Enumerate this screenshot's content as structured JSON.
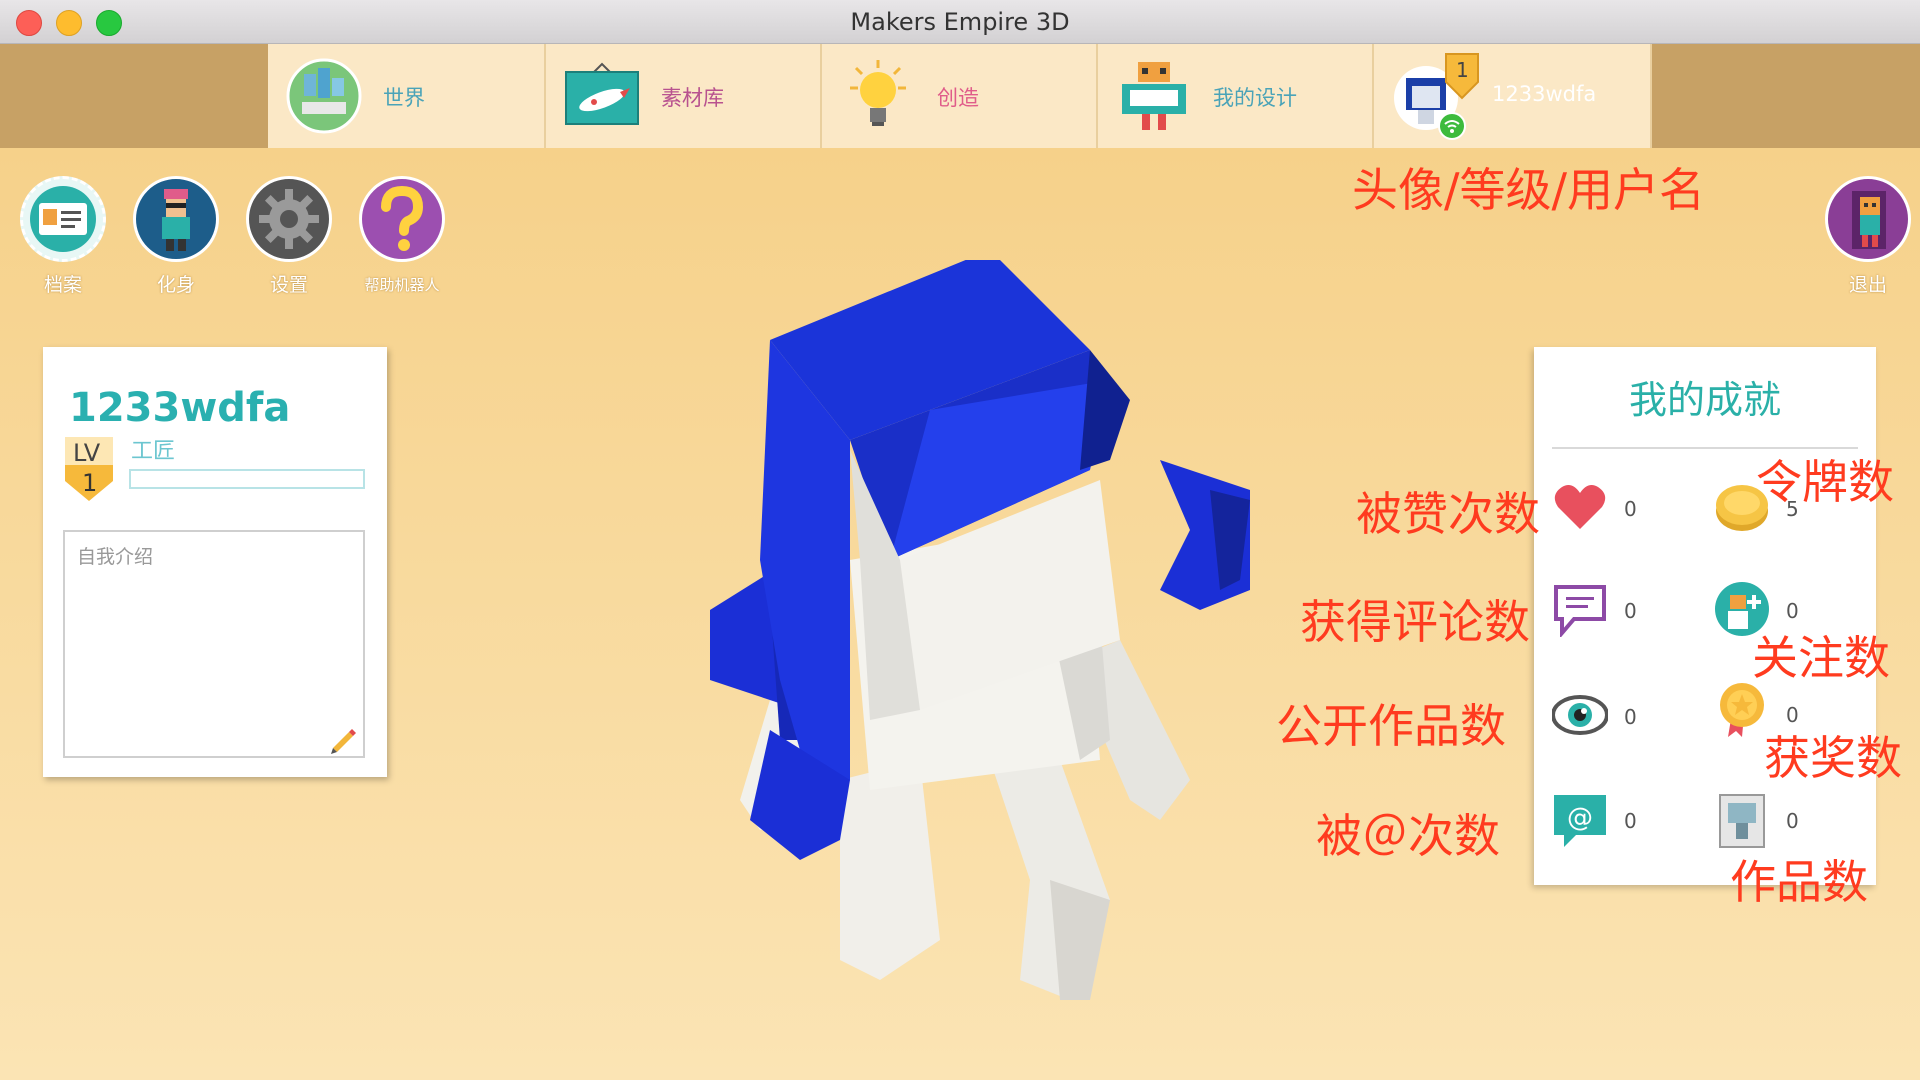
{
  "window": {
    "title": "Makers Empire 3D"
  },
  "tabs": [
    {
      "label": "世界",
      "icon": "world-icon"
    },
    {
      "label": "素材库",
      "icon": "rocket-library-icon"
    },
    {
      "label": "创造",
      "icon": "lightbulb-icon"
    },
    {
      "label": "我的设计",
      "icon": "my-designs-robot-icon"
    }
  ],
  "user_tab": {
    "level": "1",
    "username": "1233wdfa",
    "icon": "avatar-icon"
  },
  "tools": [
    {
      "label": "档案",
      "icon": "profile-card-icon"
    },
    {
      "label": "化身",
      "icon": "avatar-character-icon"
    },
    {
      "label": "设置",
      "icon": "gear-icon"
    },
    {
      "label": "帮助机器人",
      "icon": "question-icon"
    }
  ],
  "logout": {
    "label": "退出",
    "icon": "exit-door-icon"
  },
  "profile": {
    "username": "1233wdfa",
    "level_prefix": "LV",
    "level": "1",
    "rank": "工匠",
    "intro_placeholder": "自我介绍"
  },
  "achievements": {
    "title": "我的成就",
    "items": [
      {
        "icon": "heart-icon",
        "value": "0"
      },
      {
        "icon": "token-coin-icon",
        "value": "5"
      },
      {
        "icon": "comment-icon",
        "value": "0"
      },
      {
        "icon": "follow-icon",
        "value": "0"
      },
      {
        "icon": "eye-icon",
        "value": "0"
      },
      {
        "icon": "medal-icon",
        "value": "0"
      },
      {
        "icon": "mention-icon",
        "value": "0"
      },
      {
        "icon": "design-count-icon",
        "value": "0"
      }
    ]
  },
  "annotations": {
    "avatar_level_username": "头像/等级/用户名",
    "likes": "被赞次数",
    "tokens": "令牌数",
    "comments": "获得评论数",
    "follows": "关注数",
    "public_works": "公开作品数",
    "awards": "获奖数",
    "mentions": "被＠次数",
    "works": "作品数"
  },
  "colors": {
    "accent": "#2ab0b0",
    "annotation": "#ff3b1f",
    "background": "#f6d48c",
    "hair": "#1b2fd6"
  }
}
